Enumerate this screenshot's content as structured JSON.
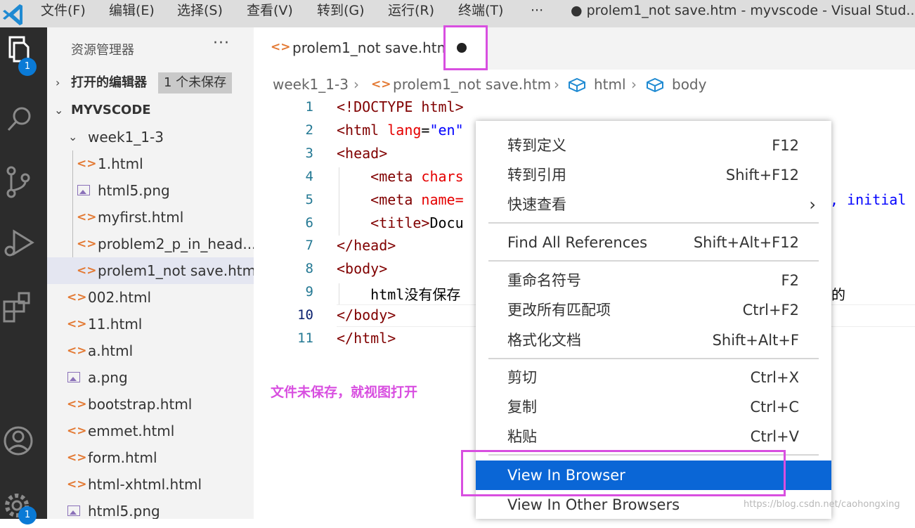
{
  "titlebar": {
    "menus": [
      "文件(F)",
      "编辑(E)",
      "选择(S)",
      "查看(V)",
      "转到(G)",
      "运行(R)",
      "终端(T)",
      "···"
    ],
    "window_title": "● prolem1_not save.htm - myvscode - Visual Stud..."
  },
  "activitybar": {
    "explorer_badge": "1",
    "settings_badge": "1"
  },
  "sidebar": {
    "title": "资源管理器",
    "more": "···",
    "open_editors": {
      "label": "打开的编辑器",
      "badge": "1 个未保存"
    },
    "workspace": "MYVSCODE",
    "folder": "week1_1-3",
    "folder_files": [
      {
        "name": "1.html",
        "type": "html"
      },
      {
        "name": "html5.png",
        "type": "image"
      },
      {
        "name": "myfirst.html",
        "type": "html"
      },
      {
        "name": "problem2_p_in_head...",
        "type": "html"
      },
      {
        "name": "prolem1_not save.htm",
        "type": "html"
      }
    ],
    "root_files": [
      {
        "name": "002.html",
        "type": "html"
      },
      {
        "name": "11.html",
        "type": "html"
      },
      {
        "name": "a.html",
        "type": "html"
      },
      {
        "name": "a.png",
        "type": "image"
      },
      {
        "name": "bootstrap.html",
        "type": "html"
      },
      {
        "name": "emmet.html",
        "type": "html"
      },
      {
        "name": "form.html",
        "type": "html"
      },
      {
        "name": "html-xhtml.html",
        "type": "html"
      },
      {
        "name": "html5.png",
        "type": "image"
      }
    ]
  },
  "editor": {
    "tab": {
      "name": "prolem1_not save.htm",
      "dirty": "●"
    },
    "breadcrumb": [
      "week1_1-3",
      "prolem1_not save.htm",
      "html",
      "body"
    ],
    "line_numbers": [
      "1",
      "2",
      "3",
      "4",
      "5",
      "6",
      "7",
      "8",
      "9",
      "10",
      "11"
    ],
    "code": {
      "l1": "<!DOCTYPE html>",
      "l2_tag": "<html ",
      "l2_attr": "lang",
      "l2_eq": "=",
      "l2_val": "\"en\"",
      "l3": "<head>",
      "l4_tag": "    <meta ",
      "l4_attr": "chars",
      "l5_tag": "    <meta ",
      "l5_attr": "name=",
      "l5_right": ", initial",
      "l6_tag": "    <title>",
      "l6_txt": "Docu",
      "l7": "</head>",
      "l8": "<body>",
      "l9": "    html没有保存",
      "l9_right": "的",
      "l10": "</body>",
      "l11": "</html>"
    },
    "annotation": "文件未保存，就视图打开"
  },
  "context_menu": {
    "items": [
      {
        "label": "转到定义",
        "key": "F12"
      },
      {
        "label": "转到引用",
        "key": "Shift+F12"
      },
      {
        "label": "快速查看",
        "key": "›"
      },
      {
        "label": "Find All References",
        "key": "Shift+Alt+F12"
      },
      {
        "label": "重命名符号",
        "key": "F2"
      },
      {
        "label": "更改所有匹配项",
        "key": "Ctrl+F2"
      },
      {
        "label": "格式化文档",
        "key": "Shift+Alt+F"
      },
      {
        "label": "剪切",
        "key": "Ctrl+X"
      },
      {
        "label": "复制",
        "key": "Ctrl+C"
      },
      {
        "label": "粘贴",
        "key": "Ctrl+V"
      },
      {
        "label": "View In Browser",
        "key": ""
      },
      {
        "label": "View In Other Browsers",
        "key": ""
      }
    ]
  },
  "watermark": "https://blog.csdn.net/caohongxing",
  "colors": {
    "accent": "#0a66d6",
    "highlight_box": "#d84fe0",
    "activitybar": "#2c2c2c",
    "sidebar": "#f3f3f3"
  }
}
